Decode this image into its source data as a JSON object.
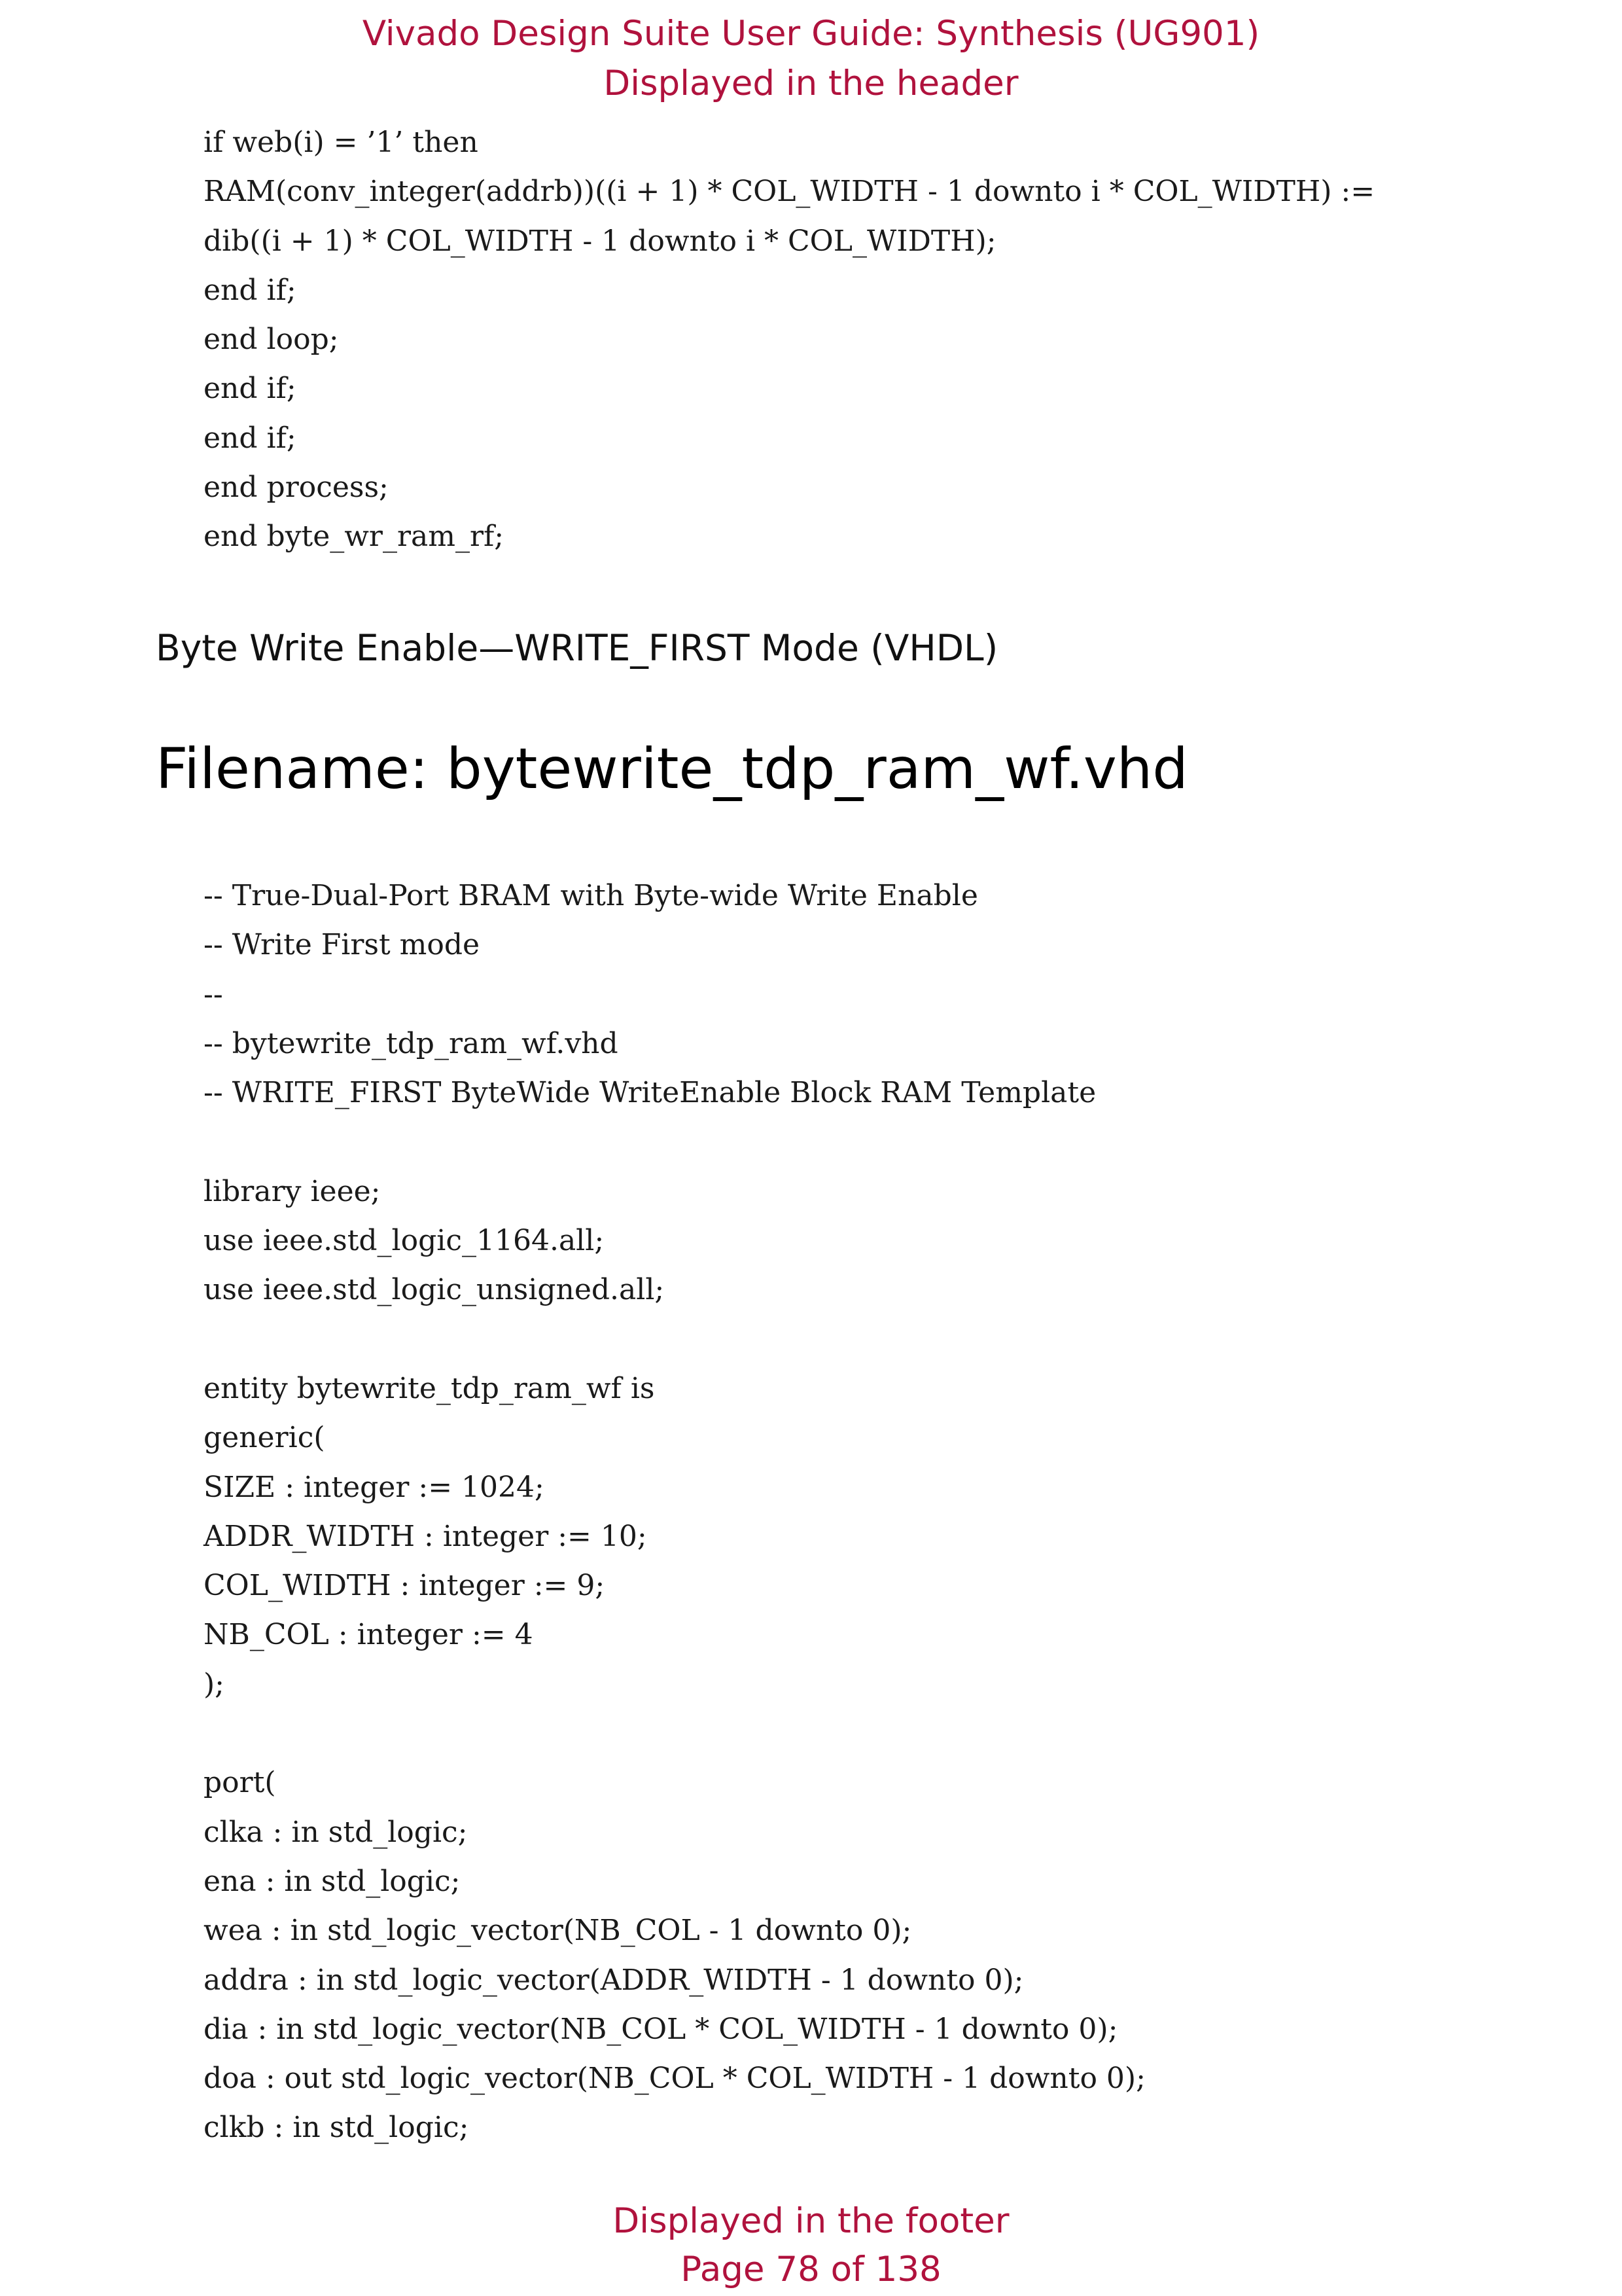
{
  "header": {
    "title": "Vivado Design Suite User Guide: Synthesis (UG901)",
    "subtitle": "Displayed in the header"
  },
  "code_top": [
    "if web(i) = ’1’ then",
    "RAM(conv_integer(addrb))((i + 1) * COL_WIDTH - 1 downto i * COL_WIDTH) :=",
    "dib((i + 1) * COL_WIDTH - 1 downto i * COL_WIDTH);",
    "end if;",
    "end loop;",
    "end if;",
    "end if;",
    "end process;",
    "end byte_wr_ram_rf;"
  ],
  "section_heading": "Byte Write Enable—WRITE_FIRST Mode (VHDL)",
  "filename_heading": "Filename: bytewrite_tdp_ram_wf.vhd",
  "code_main": [
    "-- True-Dual-Port BRAM with Byte-wide Write Enable",
    "-- Write First mode",
    "--",
    "-- bytewrite_tdp_ram_wf.vhd",
    "-- WRITE_FIRST ByteWide WriteEnable Block RAM Template",
    "",
    "library ieee;",
    "use ieee.std_logic_1164.all;",
    "use ieee.std_logic_unsigned.all;",
    "",
    "entity bytewrite_tdp_ram_wf is",
    "generic(",
    "SIZE : integer := 1024;",
    "ADDR_WIDTH : integer := 10;",
    "COL_WIDTH : integer := 9;",
    "NB_COL : integer := 4",
    ");",
    "",
    "port(",
    "clka : in std_logic;",
    "ena : in std_logic;",
    "wea : in std_logic_vector(NB_COL - 1 downto 0);",
    "addra : in std_logic_vector(ADDR_WIDTH - 1 downto 0);",
    "dia : in std_logic_vector(NB_COL * COL_WIDTH - 1 downto 0);",
    "doa : out std_logic_vector(NB_COL * COL_WIDTH - 1 downto 0);",
    "clkb : in std_logic;"
  ],
  "footer": {
    "label": "Displayed in the footer",
    "page": "Page 78 of 138"
  },
  "colors": {
    "header_footer": "#b0123d",
    "body_text": "#111111"
  }
}
